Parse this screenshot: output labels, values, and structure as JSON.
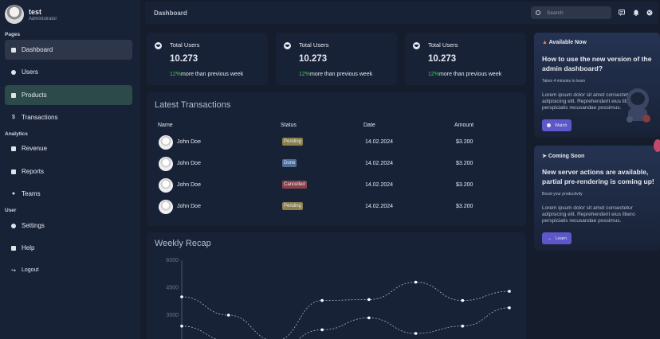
{
  "user": {
    "name": "test",
    "role": "Administrator"
  },
  "sidebar": {
    "sections": [
      {
        "title": "Pages",
        "items": [
          "Dashboard",
          "Users",
          "Products",
          "Transactions"
        ]
      },
      {
        "title": "Analytics",
        "items": [
          "Revenue",
          "Reports",
          "Teams"
        ]
      },
      {
        "title": "User",
        "items": [
          "Settings",
          "Help",
          "Logout"
        ]
      }
    ]
  },
  "topbar": {
    "title": "Dashboard",
    "search_placeholder": "Search",
    "icons": [
      "message-icon",
      "bell-icon",
      "globe-icon"
    ]
  },
  "stats": [
    {
      "label": "Total Users",
      "value": "10.273",
      "change": "12%",
      "detail": "more than previous week"
    },
    {
      "label": "Total Users",
      "value": "10.273",
      "change": "12%",
      "detail": "more than previous week"
    },
    {
      "label": "Total Users",
      "value": "10.273",
      "change": "12%",
      "detail": "more than previous week"
    }
  ],
  "transactions": {
    "title": "Latest Transactions",
    "columns": [
      "Name",
      "Status",
      "Date",
      "Amount"
    ],
    "rows": [
      {
        "name": "John Doe",
        "status": "Pending",
        "date": "14.02.2024",
        "amount": "$3.200"
      },
      {
        "name": "John Doe",
        "status": "Done",
        "date": "14.02.2024",
        "amount": "$3.200"
      },
      {
        "name": "John Doe",
        "status": "Cancelled",
        "date": "14.02.2024",
        "amount": "$3.200"
      },
      {
        "name": "John Doe",
        "status": "Pending",
        "date": "14.02.2024",
        "amount": "$3.200"
      }
    ],
    "status_colors": {
      "Pending": "#8a7f4d",
      "Done": "#4d6f9a",
      "Cancelled": "#8a4048"
    }
  },
  "chart_data": {
    "type": "line",
    "title": "Weekly Recap",
    "y_ticks": [
      6000,
      4500,
      3000
    ],
    "ylim": [
      1000,
      6000
    ],
    "series": [
      {
        "values": [
          4000,
          3000,
          1600,
          3800,
          3850,
          4800,
          3800,
          4300
        ]
      },
      {
        "values": [
          2400,
          1600,
          1200,
          2200,
          2850,
          2000,
          2400,
          3400
        ]
      }
    ]
  },
  "promos": [
    {
      "tag": "Available Now",
      "tag_icon": "fire-icon",
      "title": "How to use the new version of the admin dashboard?",
      "subtitle": "Takes 4 minutes to learn",
      "text": "Lorem ipsum dolor sit amet consectetur adipisicing elit. Reprehenderit eius libero perspiciatis recusandae possimus.",
      "button": "Watch"
    },
    {
      "tag": "Coming Soon",
      "tag_icon": "rocket-icon",
      "title": "New server actions are available, partial pre-rendering is coming up!",
      "subtitle": "Boost your productivity",
      "text": "Lorem ipsum dolor sit amet consectetur adipisicing elit. Reprehenderit eius libero perspiciatis recusandae possimus.",
      "button": "Learn"
    }
  ]
}
